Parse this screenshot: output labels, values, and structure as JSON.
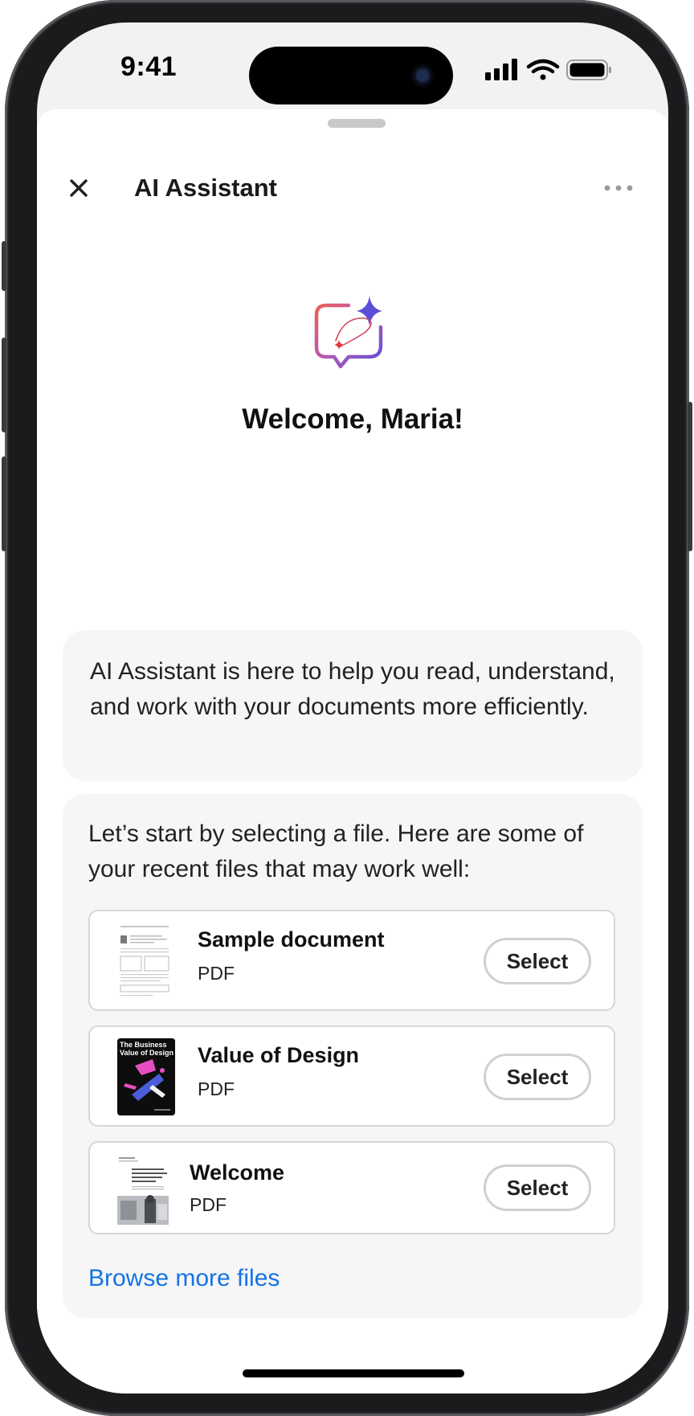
{
  "status_bar": {
    "time": "9:41",
    "icons": [
      "cellular-signal-icon",
      "wifi-icon",
      "battery-icon"
    ]
  },
  "header": {
    "title": "AI Assistant",
    "close_icon": "close-icon",
    "more_icon": "more-options-icon"
  },
  "hero": {
    "icon": "ai-assistant-chat-sparkle-icon",
    "welcome": "Welcome, Maria!"
  },
  "intro": {
    "text": "AI Assistant is here to help you read, understand, and work with your documents more efficiently."
  },
  "files": {
    "prompt": "Let’s start by selecting a file. Here are some of your recent files that may work well:",
    "items": [
      {
        "name": "Sample document",
        "type": "PDF",
        "action": "Select"
      },
      {
        "name": "Value of Design",
        "type": "PDF",
        "action": "Select",
        "thumb_text": "The Business Value of Design"
      },
      {
        "name": "Welcome",
        "type": "PDF",
        "action": "Select"
      }
    ],
    "browse_label": "Browse more files"
  },
  "colors": {
    "accent_link": "#1473e6",
    "card_bg": "#f6f6f6",
    "icon_gradient_start": "#e8605a",
    "icon_gradient_end": "#5a4fd6"
  }
}
